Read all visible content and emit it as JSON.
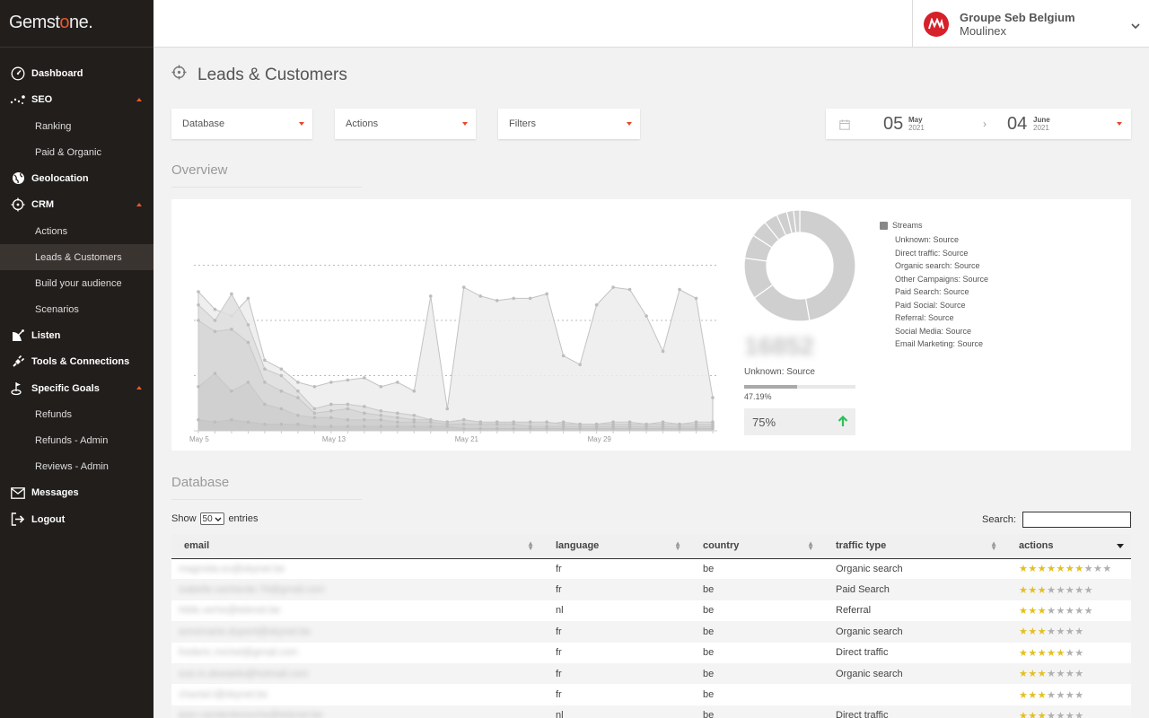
{
  "app": {
    "logo_prefix": "Gemst",
    "logo_o": "o",
    "logo_suffix": "ne."
  },
  "sidebar": {
    "items": [
      {
        "label": "Dashboard",
        "icon": "dashboard-gauge-icon",
        "type": "main"
      },
      {
        "label": "SEO",
        "icon": "seo-stars-icon",
        "type": "main",
        "expanded": true
      },
      {
        "label": "Ranking",
        "type": "sub"
      },
      {
        "label": "Paid & Organic",
        "type": "sub"
      },
      {
        "label": "Geolocation",
        "icon": "globe-icon",
        "type": "main"
      },
      {
        "label": "CRM",
        "icon": "crosshair-icon",
        "type": "main",
        "expanded": true
      },
      {
        "label": "Actions",
        "type": "sub"
      },
      {
        "label": "Leads & Customers",
        "type": "sub",
        "active": true
      },
      {
        "label": "Build your audience",
        "type": "sub"
      },
      {
        "label": "Scenarios",
        "type": "sub"
      },
      {
        "label": "Listen",
        "icon": "satellite-dish-icon",
        "type": "main"
      },
      {
        "label": "Tools & Connections",
        "icon": "plug-icon",
        "type": "main"
      },
      {
        "label": "Specific Goals",
        "icon": "goal-flag-icon",
        "type": "main",
        "expanded": true
      },
      {
        "label": "Refunds",
        "type": "sub"
      },
      {
        "label": "Refunds - Admin",
        "type": "sub"
      },
      {
        "label": "Reviews - Admin",
        "type": "sub"
      },
      {
        "label": "Messages",
        "icon": "envelope-icon",
        "type": "main"
      },
      {
        "label": "Logout",
        "icon": "logout-icon",
        "type": "main"
      }
    ]
  },
  "account": {
    "name": "Groupe Seb Belgium",
    "brand": "Moulinex"
  },
  "page": {
    "title": "Leads & Customers"
  },
  "toolbar": {
    "database_label": "Database",
    "actions_label": "Actions",
    "filters_label": "Filters"
  },
  "daterange": {
    "from_day": "05",
    "from_month": "May",
    "from_year": "2021",
    "to_day": "04",
    "to_month": "June",
    "to_year": "2021",
    "arrow": "›"
  },
  "overview": {
    "title": "Overview",
    "stat_label": "Unknown: Source",
    "stat_value_blurred": "16852",
    "stat_percent": "47.19%",
    "stat_fraction": 0.4719,
    "stat_change": "75%"
  },
  "legend": {
    "title": "Streams",
    "items": [
      "Unknown: Source",
      "Direct traffic: Source",
      "Organic search: Source",
      "Other Campaigns: Source",
      "Paid Search: Source",
      "Paid Social: Source",
      "Referral: Source",
      "Social Media: Source",
      "Email Marketing: Source"
    ]
  },
  "chart_data": [
    {
      "type": "area",
      "x_ticks": [
        "May 5",
        "May 13",
        "May 21",
        "May 29"
      ],
      "series": [
        {
          "values": [
            63,
            55,
            52,
            60,
            32,
            28,
            22,
            20,
            22,
            23,
            24,
            20,
            22,
            18,
            61,
            10,
            65,
            61,
            59,
            60,
            60,
            62,
            34,
            30,
            57,
            65,
            64,
            52,
            36,
            64,
            60,
            15
          ]
        },
        {
          "values": [
            57,
            50,
            62,
            48,
            28,
            25,
            18,
            10,
            12,
            12,
            11,
            9,
            8,
            7,
            5,
            4,
            5,
            4,
            3,
            4,
            3,
            3,
            4,
            3,
            3,
            4,
            4,
            3,
            4,
            3,
            4,
            4
          ]
        },
        {
          "values": [
            50,
            45,
            46,
            40,
            22,
            18,
            15,
            8,
            9,
            10,
            8,
            7,
            6,
            5,
            5,
            4,
            5,
            4,
            4,
            4,
            4,
            4,
            3,
            3,
            3,
            3,
            3,
            3,
            3,
            3,
            3,
            3
          ]
        },
        {
          "values": [
            20,
            26,
            18,
            22,
            12,
            10,
            7,
            6,
            6,
            5,
            5,
            5,
            4,
            4,
            4,
            3,
            3,
            3,
            3,
            3,
            2,
            2,
            2,
            2,
            2,
            2,
            2,
            2,
            2,
            2,
            2,
            2
          ]
        },
        {
          "values": [
            5,
            4,
            5,
            4,
            3,
            3,
            3,
            2,
            2,
            2,
            2,
            2,
            2,
            2,
            2,
            2,
            1,
            1,
            1,
            1,
            1,
            1,
            1,
            1,
            1,
            1,
            1,
            1,
            1,
            1,
            1,
            1
          ]
        }
      ],
      "ylim": [
        0,
        100
      ],
      "grid": "dotted horizontal"
    },
    {
      "type": "pie",
      "donut": true,
      "slices": [
        47.19,
        18,
        12,
        7,
        5,
        4,
        3,
        2,
        1.81
      ]
    }
  ],
  "table": {
    "section_title": "Database",
    "show_label": "Show",
    "show_value": "50",
    "entries_label": "entries",
    "search_label": "Search:",
    "columns": [
      "email",
      "language",
      "country",
      "traffic type",
      "actions"
    ],
    "rows": [
      {
        "email": "magnolia.eu@skynet.be",
        "language": "fr",
        "country": "be",
        "traffic": "Organic search",
        "stars_on": 7,
        "stars_total": 10
      },
      {
        "email": "isabelle.vanherde.76@gmail.com",
        "language": "fr",
        "country": "be",
        "traffic": "Paid Search",
        "stars_on": 3,
        "stars_total": 8
      },
      {
        "email": "hilde.verhe@telenet.be",
        "language": "nl",
        "country": "be",
        "traffic": "Referral",
        "stars_on": 3,
        "stars_total": 8
      },
      {
        "email": "annemarie.dupont@skynet.be",
        "language": "fr",
        "country": "be",
        "traffic": "Organic search",
        "stars_on": 3,
        "stars_total": 7
      },
      {
        "email": "frederic.michel@gmail.com",
        "language": "fr",
        "country": "be",
        "traffic": "Direct traffic",
        "stars_on": 5,
        "stars_total": 7
      },
      {
        "email": "sue.m.dewaele@hotmail.com",
        "language": "fr",
        "country": "be",
        "traffic": "Organic search",
        "stars_on": 3,
        "stars_total": 7
      },
      {
        "email": "chantal.l@skynet.be",
        "language": "fr",
        "country": "be",
        "traffic": "",
        "stars_on": 3,
        "stars_total": 7
      },
      {
        "email": "jean.vandenbossche@telenet.be",
        "language": "nl",
        "country": "be",
        "traffic": "Direct traffic",
        "stars_on": 3,
        "stars_total": 7
      }
    ]
  }
}
